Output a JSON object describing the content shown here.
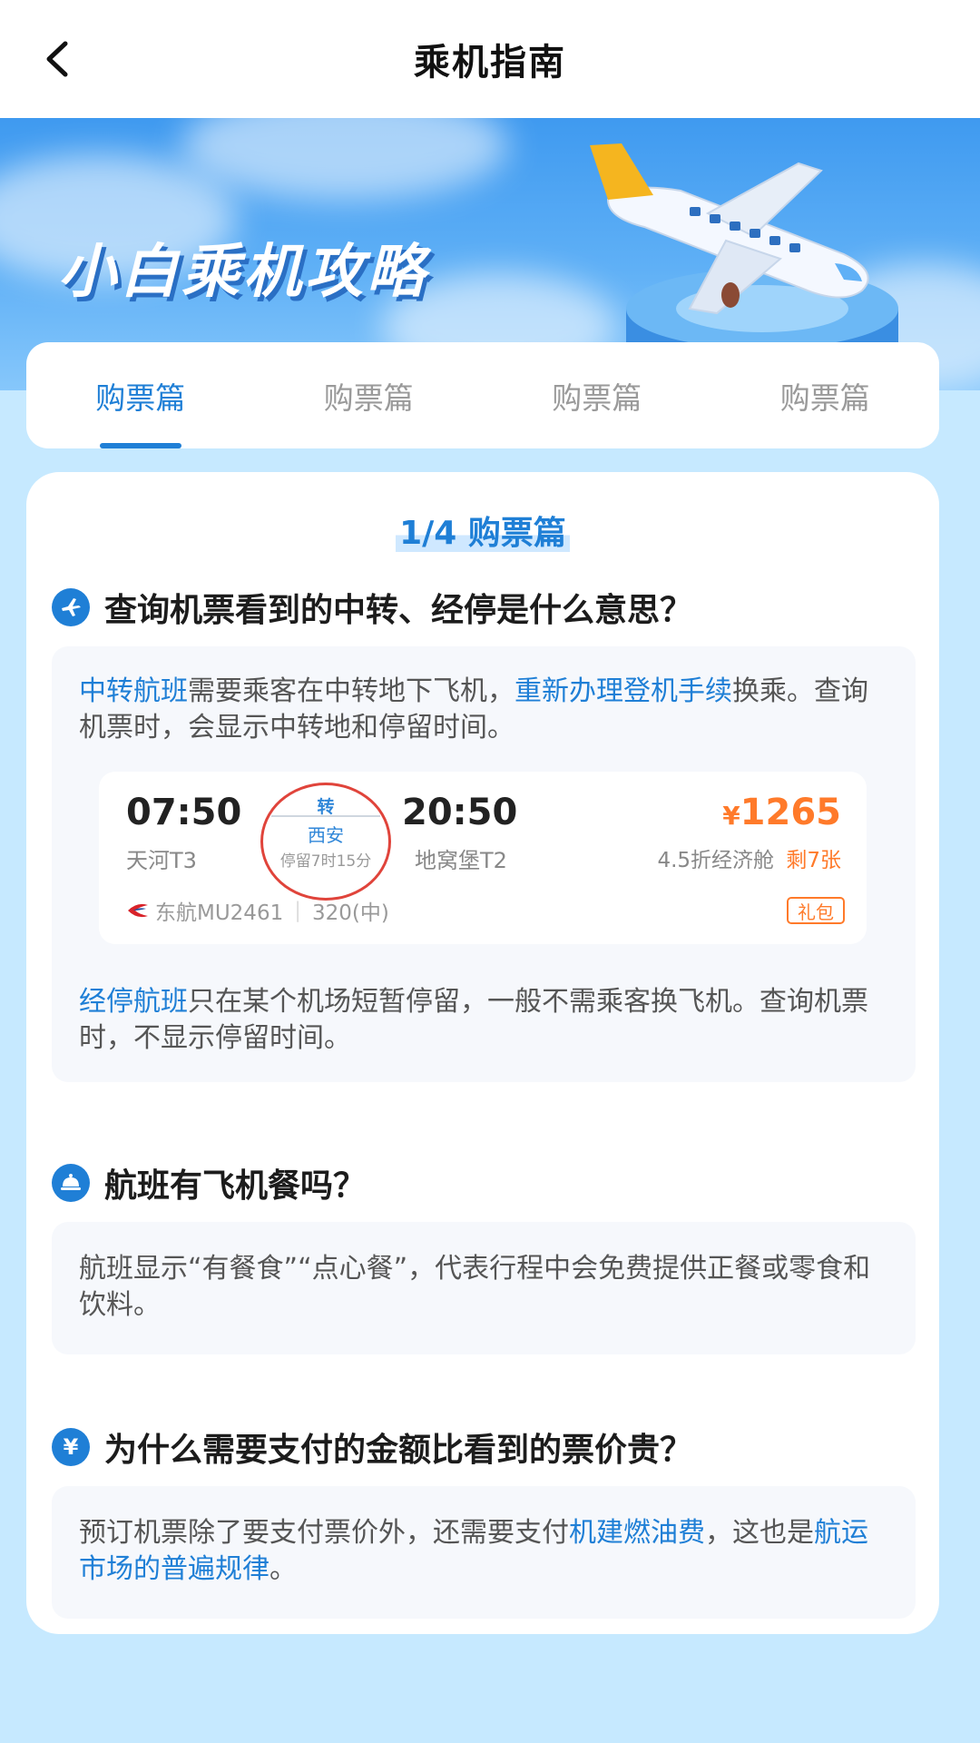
{
  "header": {
    "title": "乘机指南",
    "back_icon": "chevron-left-icon"
  },
  "banner": {
    "title": "小白乘机攻略",
    "illustration": "airplane-icon"
  },
  "tabs": [
    {
      "label": "购票篇",
      "active": true
    },
    {
      "label": "购票篇",
      "active": false
    },
    {
      "label": "购票篇",
      "active": false
    },
    {
      "label": "购票篇",
      "active": false
    }
  ],
  "section": {
    "progress": "1/4 购票篇"
  },
  "q1": {
    "icon": "plane-icon",
    "title": "查询机票看到的中转、经停是什么意思？",
    "p1_hl1": "中转航班",
    "p1_t1": "需要乘客在中转地下飞机，",
    "p1_hl2": "重新办理登机手续",
    "p1_t2": "换乘。查询机票时，会显示中转地和停留时间。",
    "p2_hl1": "经停航班",
    "p2_t1": "只在某个机场短暂停留，一般不需乘客换飞机。查询机票时，不显示停留时间。"
  },
  "flight": {
    "dep_time": "07:50",
    "dep_airport": "天河T3",
    "transfer_label": "转",
    "transfer_city": "西安",
    "transfer_stay": "停留7时15分",
    "arr_time": "20:50",
    "arr_airport": "地窝堡T2",
    "currency": "¥",
    "price": "1265",
    "cabin": "4.5折经济舱",
    "remaining": "剩7张",
    "airline": "东航MU2461",
    "aircraft": "320(中)",
    "gift": "礼包",
    "airline_icon": "china-eastern-logo-icon"
  },
  "q2": {
    "icon": "meal-cloche-icon",
    "title": "航班有飞机餐吗？",
    "text": "航班显示“有餐食”“点心餐”，代表行程中会免费提供正餐或零食和饮料。"
  },
  "q3": {
    "icon": "yen-icon",
    "icon_glyph": "¥",
    "title": "为什么需要支付的金额比看到的票价贵？",
    "t1": "预订机票除了要支付票价外，还需要支付",
    "hl1": "机建燃油费",
    "t2": "，这也是",
    "hl2": "航运市场的普遍规律",
    "t3": "。"
  },
  "colors": {
    "accent": "#1f7fd6",
    "price": "#ff7a2a",
    "transfer_circle": "#e0443b"
  }
}
